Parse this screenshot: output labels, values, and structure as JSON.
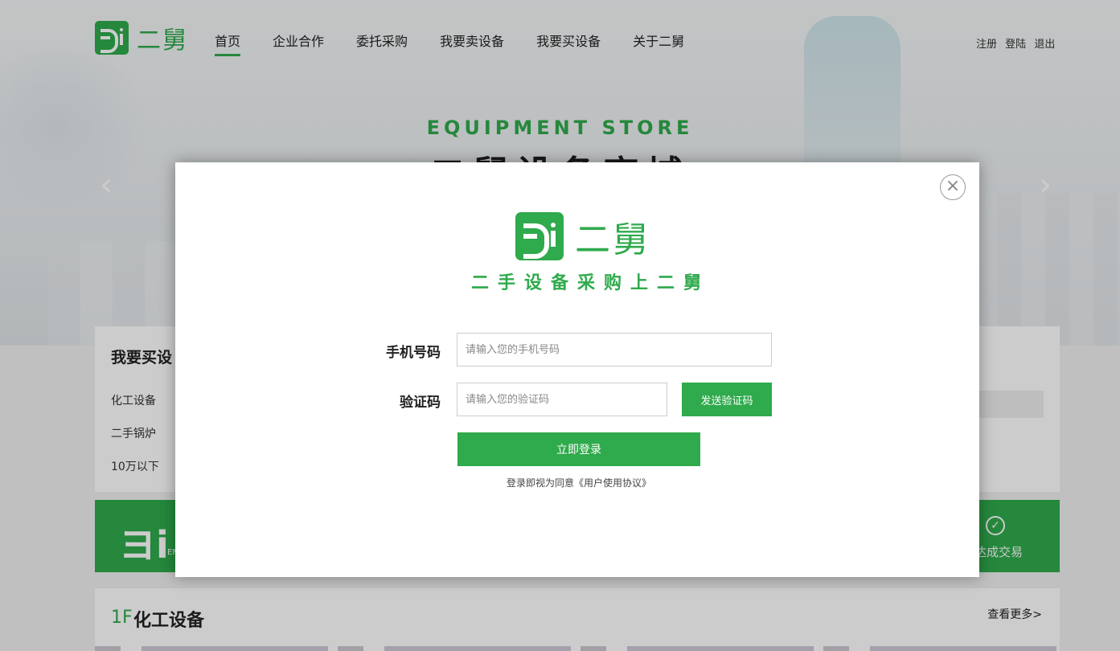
{
  "header": {
    "logo_text": "二舅",
    "nav": [
      "首页",
      "企业合作",
      "委托采购",
      "我要卖设备",
      "我要买设备",
      "关于二舅"
    ],
    "auth": [
      "注册",
      "登陆",
      "退出"
    ]
  },
  "hero": {
    "title_en": "EQUIPMENT STORE",
    "title_zh": "二舅设备商城"
  },
  "buy_section": {
    "title": "我要买设",
    "categories": [
      "化工设备",
      "二手锅炉",
      "10万以下"
    ]
  },
  "banner": {
    "deal_text": "达成交易",
    "en_text": "EN"
  },
  "floor": {
    "number": "1F",
    "title": "化工设备",
    "more": "查看更多>"
  },
  "modal": {
    "logo_text": "二舅",
    "slogan": "二手设备采购上二舅",
    "phone_label": "手机号码",
    "phone_placeholder": "请输入您的手机号码",
    "code_label": "验证码",
    "code_placeholder": "请输入您的验证码",
    "send_code": "发送验证码",
    "login": "立即登录",
    "agreement": "登录即视为同意《用户使用协议》",
    "close_symbol": "×"
  },
  "colors": {
    "brand_green": "#2faa4c"
  }
}
